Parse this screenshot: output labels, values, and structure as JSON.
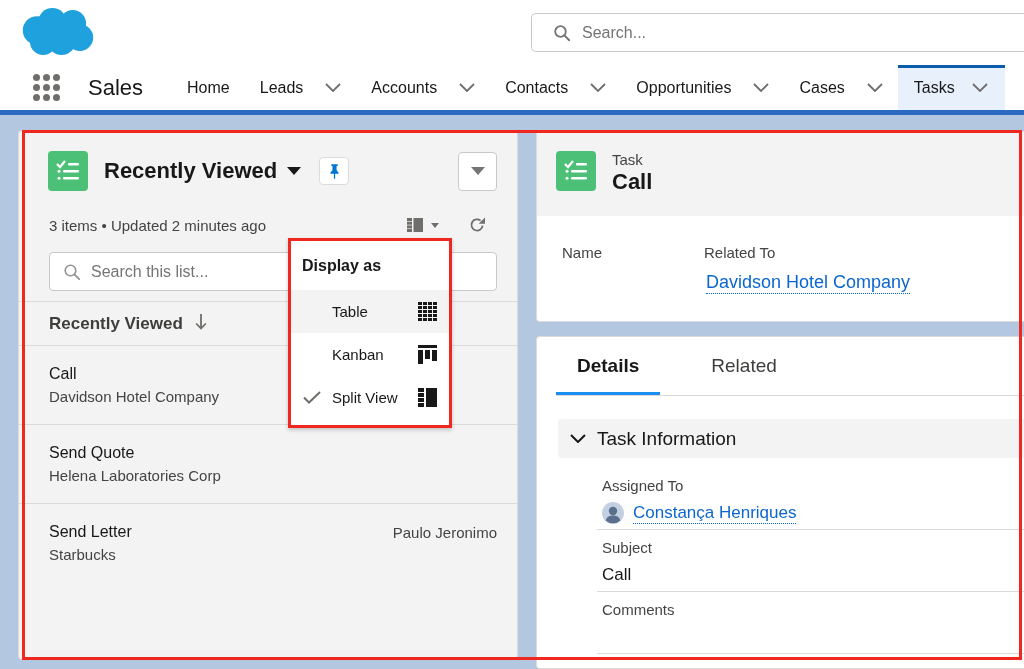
{
  "header": {
    "search": {
      "placeholder": "Search..."
    }
  },
  "nav": {
    "app_name": "Sales",
    "items": [
      {
        "label": "Home",
        "has_menu": false,
        "selected": false
      },
      {
        "label": "Leads",
        "has_menu": true,
        "selected": false
      },
      {
        "label": "Accounts",
        "has_menu": true,
        "selected": false
      },
      {
        "label": "Contacts",
        "has_menu": true,
        "selected": false
      },
      {
        "label": "Opportunities",
        "has_menu": true,
        "selected": false
      },
      {
        "label": "Cases",
        "has_menu": true,
        "selected": false
      },
      {
        "label": "Tasks",
        "has_menu": true,
        "selected": true
      }
    ]
  },
  "workspace": {
    "highlighted": true
  },
  "list_view": {
    "title": "Recently Viewed",
    "summary": "3 items • Updated 2 minutes ago",
    "search": {
      "placeholder": "Search this list..."
    },
    "sort_column": "Recently Viewed",
    "rows": [
      {
        "title": "Call",
        "subtitle": "Davidson Hotel Company"
      },
      {
        "title": "Send Quote",
        "subtitle": "Helena Laboratories Corp"
      },
      {
        "title": "Send Letter",
        "subtitle": "Starbucks",
        "assignee": "Paulo Jeronimo"
      }
    ]
  },
  "display_menu": {
    "title": "Display as",
    "highlighted": true,
    "items": [
      {
        "label": "Table",
        "kind": "table",
        "selected": false,
        "hovered": true
      },
      {
        "label": "Kanban",
        "kind": "kanban",
        "selected": false,
        "hovered": false
      },
      {
        "label": "Split View",
        "kind": "split",
        "selected": true,
        "hovered": false
      }
    ]
  },
  "record": {
    "object_type": "Task",
    "title": "Call",
    "highlights": [
      {
        "label": "Name"
      },
      {
        "label": "Related To",
        "value": "Davidson Hotel Company"
      }
    ],
    "tabs": [
      {
        "label": "Details",
        "selected": true
      },
      {
        "label": "Related",
        "selected": false
      }
    ],
    "section": {
      "title": "Task Information",
      "expanded": true,
      "fields": [
        {
          "label": "Assigned To",
          "kind": "user",
          "value": "Constança Henriques"
        },
        {
          "label": "Subject",
          "kind": "text",
          "value": "Call"
        },
        {
          "label": "Comments",
          "kind": "text"
        }
      ]
    }
  }
}
